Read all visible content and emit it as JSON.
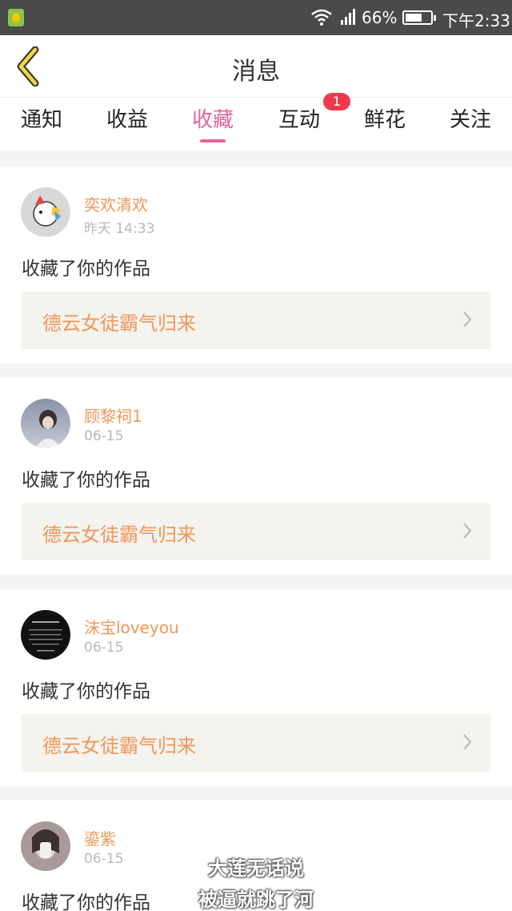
{
  "status_bar": {
    "battery_percent": "66%",
    "battery_level": 0.66,
    "time": "下午2:33"
  },
  "nav": {
    "title": "消息"
  },
  "tabs": [
    {
      "label": "通知",
      "active": false
    },
    {
      "label": "收益",
      "active": false
    },
    {
      "label": "收藏",
      "active": true
    },
    {
      "label": "互动",
      "active": false,
      "badge": "1"
    },
    {
      "label": "鲜花",
      "active": false
    },
    {
      "label": "关注",
      "active": false
    }
  ],
  "items": [
    {
      "username": "奕欢清欢",
      "date": "昨天 14:33",
      "action": "收藏了你的作品",
      "work_title": "德云女徒霸气归来"
    },
    {
      "username": "顾黎祠1",
      "date": "06-15",
      "action": "收藏了你的作品",
      "work_title": "德云女徒霸气归来"
    },
    {
      "username": "沫宝loveyou",
      "date": "06-15",
      "action": "收藏了你的作品",
      "work_title": "德云女徒霸气归来"
    },
    {
      "username": "鎏紫",
      "date": "06-15",
      "action": "收藏了你的作品"
    }
  ],
  "overlay": {
    "line1": "大莲无话说",
    "line2": "被逼就跳了河"
  },
  "colors": {
    "accent": "#e8629a",
    "username": "#f0975a",
    "badge": "#f0394f"
  }
}
